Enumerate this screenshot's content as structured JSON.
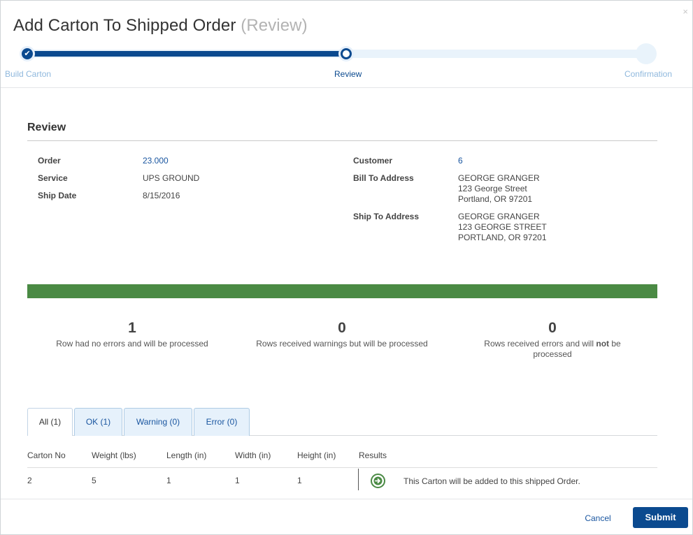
{
  "dialog": {
    "title": "Add Carton To Shipped Order",
    "subtitle": "(Review)",
    "close_glyph": "×"
  },
  "stepper": {
    "steps": [
      {
        "label": "Build Carton",
        "state": "done"
      },
      {
        "label": "Review",
        "state": "current"
      },
      {
        "label": "Confirmation",
        "state": "future"
      }
    ],
    "done_glyph": "✔"
  },
  "review": {
    "heading": "Review",
    "left": [
      {
        "label": "Order",
        "value": "23.000"
      },
      {
        "label": "Service",
        "value": "UPS GROUND"
      },
      {
        "label": "Ship Date",
        "value": "8/15/2016"
      }
    ],
    "right": {
      "customer": {
        "label": "Customer",
        "value": "6"
      },
      "bill_to": {
        "label": "Bill To Address",
        "lines": [
          "GEORGE GRANGER",
          "123 George Street",
          "Portland, OR 97201"
        ]
      },
      "ship_to": {
        "label": "Ship To Address",
        "lines": [
          "GEORGE GRANGER",
          "123 GEORGE STREET",
          "PORTLAND, OR 97201"
        ]
      }
    }
  },
  "status": {
    "bar_color": "#4a8a44",
    "ok": {
      "count": "1",
      "text": "Row had no errors and will be processed"
    },
    "warnings": {
      "count": "0",
      "text": "Rows received warnings but will be processed"
    },
    "errors": {
      "count": "0",
      "text_before": "Rows received errors and will ",
      "text_bold": "not",
      "text_after": " be processed"
    }
  },
  "tabs": [
    {
      "label": "All (1)",
      "active": true
    },
    {
      "label": "OK (1)",
      "active": false
    },
    {
      "label": "Warning (0)",
      "active": false
    },
    {
      "label": "Error (0)",
      "active": false
    }
  ],
  "table": {
    "columns": [
      "Carton No",
      "Weight (lbs)",
      "Length (in)",
      "Width (in)",
      "Height (in)",
      "Results"
    ],
    "rows": [
      {
        "carton_no": "2",
        "weight": "5",
        "length": "1",
        "width": "1",
        "height": "1",
        "result_icon": "arrow-right-circle-icon",
        "result_text": "This Carton will be added to this shipped Order."
      }
    ]
  },
  "footer": {
    "cancel_label": "Cancel",
    "submit_label": "Submit"
  },
  "colors": {
    "primary": "#0b4a8f",
    "link": "#1a56a0",
    "success": "#4a8a44"
  }
}
